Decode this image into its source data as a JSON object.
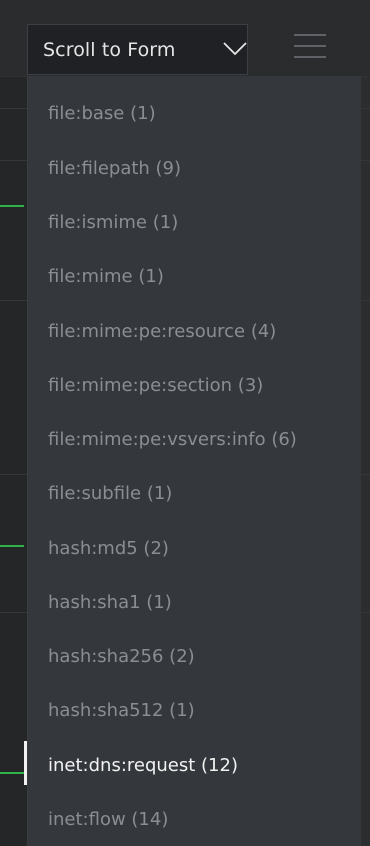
{
  "header": {
    "scroll_button_label": "Scroll to Form",
    "scroll_button_icon": "chevron-down-icon",
    "menu_icon": "hamburger-menu-icon"
  },
  "dropdown": {
    "items": [
      {
        "label": "file:base (1)"
      },
      {
        "label": "file:filepath (9)"
      },
      {
        "label": "file:ismime (1)"
      },
      {
        "label": "file:mime (1)"
      },
      {
        "label": "file:mime:pe:resource (4)"
      },
      {
        "label": "file:mime:pe:section (3)"
      },
      {
        "label": "file:mime:pe:vsvers:info (6)"
      },
      {
        "label": "file:subfile (1)"
      },
      {
        "label": "hash:md5 (2)"
      },
      {
        "label": "hash:sha1 (1)"
      },
      {
        "label": "hash:sha256 (2)"
      },
      {
        "label": "hash:sha512 (1)"
      },
      {
        "label": "inet:dns:request (12)",
        "active": true
      },
      {
        "label": "inet:flow (14)"
      }
    ]
  },
  "colors": {
    "active_text": "#f2f2f2",
    "inactive_text": "#8a8e92",
    "background_marker": "#2eb34a"
  }
}
